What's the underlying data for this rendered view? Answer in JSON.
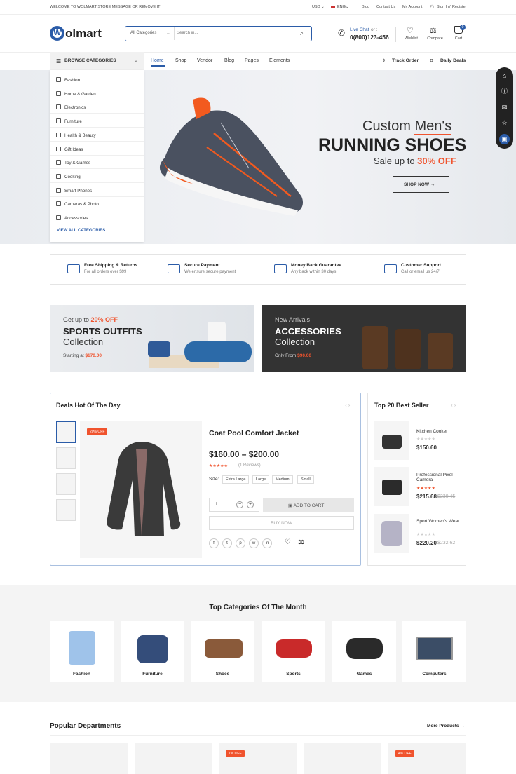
{
  "topbar": {
    "welcome": "WELCOME TO WOLMART STORE MESSAGE OR REMOVE IT!",
    "currency": "USD",
    "language": "ENG",
    "links": [
      "Blog",
      "Contact Us",
      "My Account"
    ],
    "signin": "Sign In",
    "register": "Register"
  },
  "header": {
    "logo_letter": "W",
    "logo_text": "olmart",
    "search_category": "All Categories",
    "search_placeholder": "Search in...",
    "live_chat": "Live Chat",
    "live_chat_suffix": "or :",
    "phone": "0(800)123-456",
    "wishlist": "Wishlist",
    "compare": "Compare",
    "cart": "Cart",
    "cart_count": "0"
  },
  "nav": {
    "browse": "BROWSE CATEGORIES",
    "items": [
      "Home",
      "Shop",
      "Vendor",
      "Blog",
      "Pages",
      "Elements"
    ],
    "track": "Track Order",
    "deals": "Daily Deals"
  },
  "categories": {
    "items": [
      "Fashion",
      "Home & Garden",
      "Electronics",
      "Furniture",
      "Health & Beauty",
      "Gift Ideas",
      "Toy & Games",
      "Cooking",
      "Smart Phones",
      "Cameras & Photo",
      "Accessories"
    ],
    "view_all": "VIEW ALL CATEGORIES"
  },
  "hero": {
    "title_a": "Custom ",
    "title_b": "Men's",
    "headline": "RUNNING SHOES",
    "sale_prefix": "Sale up to ",
    "sale_value": "30% OFF",
    "button": "SHOP NOW"
  },
  "features": [
    {
      "title": "Free Shipping & Returns",
      "sub": "For all orders over $99"
    },
    {
      "title": "Secure Payment",
      "sub": "We ensure secure payment"
    },
    {
      "title": "Money Back Guarantee",
      "sub": "Any back within 30 days"
    },
    {
      "title": "Customer Support",
      "sub": "Call or email us 24/7"
    }
  ],
  "banner1": {
    "line1_a": "Get up to ",
    "line1_b": "20% OFF",
    "line2": "SPORTS OUTFITS",
    "line3": "Collection",
    "price_prefix": "Starting at ",
    "price": "$170.00"
  },
  "banner2": {
    "line1": "New Arrivals",
    "line2": "ACCESSORIES",
    "line3": "Collection",
    "price_prefix": "Only From ",
    "price": "$90.00"
  },
  "deals": {
    "title": "Deals Hot Of The Day",
    "badge": "20% OFF",
    "product_name": "Coat Pool Comfort Jacket",
    "price": "$160.00 – $200.00",
    "reviews": "(1 Reviews)",
    "size_label": "Size:",
    "sizes": [
      "Extra Large",
      "Large",
      "Medium",
      "Small"
    ],
    "qty": "1",
    "add_to_cart": "ADD TO CART",
    "buy_now": "BUY NOW",
    "share": [
      "f",
      "t",
      "p",
      "w",
      "in"
    ]
  },
  "bestseller": {
    "title": "Top 20 Best Seller",
    "items": [
      {
        "name": "Kitchen Cooker",
        "price": "$150.60",
        "old": ""
      },
      {
        "name": "Professional Pixel Camera",
        "price": "$215.68",
        "old": "$230.45"
      },
      {
        "name": "Sport Women's Wear",
        "price": "$220.20",
        "old": "$232.62"
      }
    ]
  },
  "topcats": {
    "title": "Top Categories Of The Month",
    "items": [
      "Fashion",
      "Furniture",
      "Shoes",
      "Sports",
      "Games",
      "Computers"
    ]
  },
  "popular": {
    "title": "Popular Departments",
    "more": "More Products",
    "badges": [
      "7% OFF",
      "4% OFF"
    ]
  },
  "colors": {
    "accent": "#2b5ca8",
    "sale": "#f0532d",
    "dark": "#222222"
  }
}
